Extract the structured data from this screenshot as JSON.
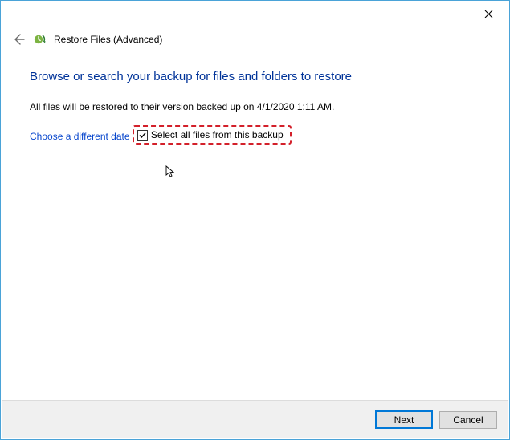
{
  "window": {
    "title": "Restore Files (Advanced)"
  },
  "heading": "Browse or search your backup for files and folders to restore",
  "description": "All files will be restored to their version backed up on 4/1/2020 1:11 AM.",
  "link": "Choose a different date",
  "checkbox": {
    "label": "Select all files from this backup",
    "checked": true
  },
  "footer": {
    "next": "Next",
    "cancel": "Cancel"
  }
}
